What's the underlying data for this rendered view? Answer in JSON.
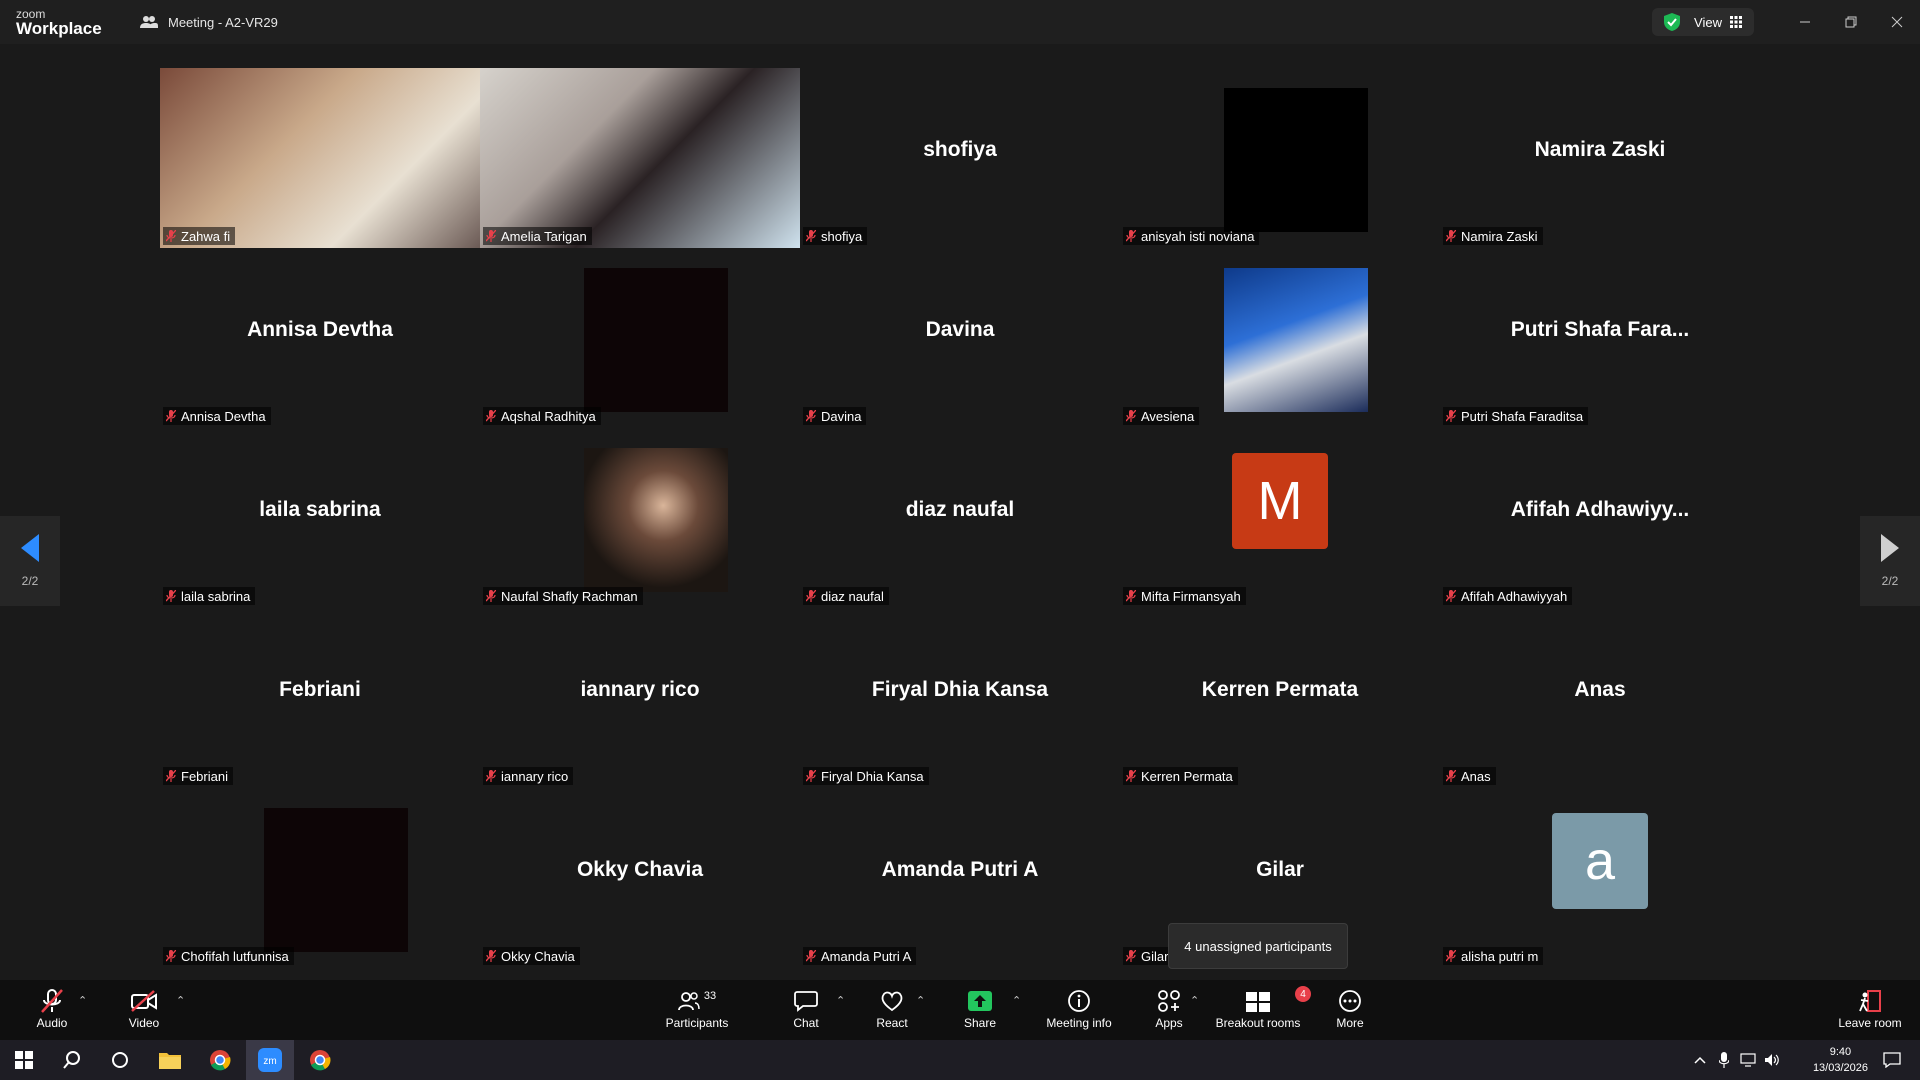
{
  "app": {
    "logo_top": "zoom",
    "logo_bottom": "Workplace",
    "meeting_title": "Meeting - A2-VR29",
    "view_label": "View"
  },
  "colors": {
    "mute_red": "#e8404a",
    "share_green": "#23c55e",
    "avatar_m": "#c73a15",
    "avatar_a": "#7b9aa8"
  },
  "tiles": [
    {
      "label": "Zahwa fi",
      "kind": "video"
    },
    {
      "label": "Amelia Tarigan",
      "kind": "video"
    },
    {
      "label": "shofiya",
      "big": "shofiya",
      "kind": "name"
    },
    {
      "label": "anisyah isti noviana",
      "kind": "black"
    },
    {
      "label": "Namira Zaski",
      "big": "Namira Zaski",
      "kind": "name"
    },
    {
      "label": "Annisa Devtha",
      "big": "Annisa Devtha",
      "kind": "name"
    },
    {
      "label": "Aqshal Radhitya",
      "kind": "dark"
    },
    {
      "label": "Davina",
      "big": "Davina",
      "kind": "name"
    },
    {
      "label": "Avesiena",
      "kind": "photo"
    },
    {
      "label": "Putri Shafa Faraditsa",
      "big": "Putri Shafa Fara...",
      "kind": "name"
    },
    {
      "label": "laila sabrina",
      "big": "laila sabrina",
      "kind": "name"
    },
    {
      "label": "Naufal Shafly Rachman",
      "kind": "photo2"
    },
    {
      "label": "diaz naufal",
      "big": "diaz naufal",
      "kind": "name"
    },
    {
      "label": "Mifta Firmansyah",
      "avatar": "M",
      "kind": "avatar"
    },
    {
      "label": "Afifah Adhawiyyah",
      "big": "Afifah Adhawiyy...",
      "kind": "name"
    },
    {
      "label": "Febriani",
      "big": "Febriani",
      "kind": "name"
    },
    {
      "label": "iannary rico",
      "big": "iannary rico",
      "kind": "name"
    },
    {
      "label": "Firyal Dhia Kansa",
      "big": "Firyal Dhia Kansa",
      "kind": "name"
    },
    {
      "label": "Kerren Permata",
      "big": "Kerren Permata",
      "kind": "name"
    },
    {
      "label": "Anas",
      "big": "Anas",
      "kind": "name"
    },
    {
      "label": "Chofifah lutfunnisa",
      "kind": "dark"
    },
    {
      "label": "Okky Chavia",
      "big": "Okky Chavia",
      "kind": "name"
    },
    {
      "label": "Amanda Putri A",
      "big": "Amanda Putri A",
      "kind": "name"
    },
    {
      "label": "Gilar",
      "big": "Gilar",
      "kind": "name"
    },
    {
      "label": "alisha putri m",
      "avatar": "a",
      "kind": "avatar"
    }
  ],
  "pager": {
    "left_page": "2/2",
    "right_page": "2/2"
  },
  "tooltip": "4 unassigned participants",
  "toolbar": {
    "audio": "Audio",
    "video": "Video",
    "participants": "Participants",
    "participants_count": "33",
    "chat": "Chat",
    "react": "React",
    "share": "Share",
    "meeting_info": "Meeting info",
    "apps": "Apps",
    "breakout": "Breakout rooms",
    "breakout_badge": "4",
    "more": "More",
    "leave": "Leave room"
  },
  "taskbar": {
    "time": "9:40",
    "date": "13/03/2026"
  }
}
